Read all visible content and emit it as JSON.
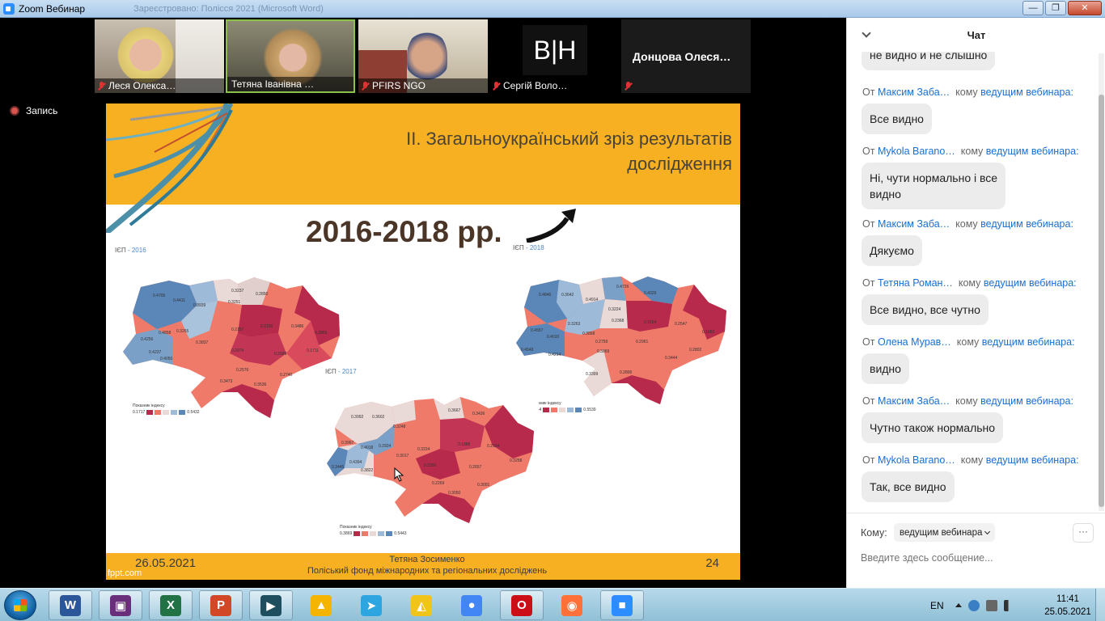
{
  "window": {
    "title": "Zoom Вебинар",
    "background_title": "Зареєстровано: Полісся 2021 (Microsoft Word)",
    "buttons": {
      "minimize": "—",
      "maximize": "❐",
      "close": "✕"
    }
  },
  "participants": [
    {
      "name": "Леся Олекса…",
      "muted": true,
      "active": false
    },
    {
      "name": "Тетяна Іванівна …",
      "muted": false,
      "active": true
    },
    {
      "name": "PFIRS NGO",
      "muted": true,
      "active": false
    },
    {
      "name": "Сергій Воло…",
      "muted": true,
      "active": false,
      "logo": "В|Н"
    },
    {
      "name": "Донцова  Олеся…",
      "muted": true,
      "active": false
    }
  ],
  "recording_label": "Запись",
  "slide": {
    "title_line1": "ІІ. Загальноукраїнський зріз  результатів",
    "title_line2": "дослідження",
    "years": "2016-2018 рр.",
    "maps": [
      {
        "label_prefix": "ІЄП",
        "label_year": " - 2016",
        "legend_title": "Показник індексу",
        "legend_min": "0.1717",
        "legend_max": "0.5432",
        "region_values": [
          "0.4705",
          "0.4411",
          "0.3939",
          "0.3237",
          "0.3251",
          "0.2850",
          "0.4256",
          "0.4858",
          "0.3265",
          "0.2157",
          "0.2156",
          "0.3486",
          "0.3837",
          "0.4237",
          "0.4050",
          "0.3869",
          "0.2074",
          "0.2689",
          "0.1711",
          "0.2576",
          "0.3536",
          "0.2740",
          "0.3473"
        ]
      },
      {
        "label_prefix": "ІЄП",
        "label_year": " - 2017",
        "legend_title": "Показник індексу",
        "legend_min": "0.3869",
        "legend_max": "0.5443",
        "region_values": [
          "0.3992",
          "0.3602",
          "0.3667",
          "0.3436",
          "0.3248",
          "0.3967",
          "0.4018",
          "0.2924",
          "0.3224",
          "0.4394",
          "0.3017",
          "0.1888",
          "0.2154",
          "0.3445",
          "0.3822",
          "0.2950",
          "0.2657",
          "0.2269",
          "0.3258",
          "0.3050",
          "0.3001"
        ]
      },
      {
        "label_prefix": "ІЄП",
        "label_year": " - 2018",
        "legend_title": "Показник індексу",
        "legend_min": "0.1664",
        "legend_max": "0.5539",
        "region_values": [
          "0.4846",
          "0.3642",
          "0.4914",
          "0.4726",
          "0.4029",
          "0.4557",
          "0.4010",
          "0.3263",
          "0.3224",
          "0.2368",
          "0.1624",
          "0.2547",
          "0.4548",
          "0.4214",
          "0.3868",
          "0.2759",
          "0.3869",
          "0.2961",
          "0.1669",
          "0.3444",
          "0.2802",
          "0.2806",
          "0.3399"
        ]
      }
    ],
    "footer_date": "26.05.2021",
    "footer_author": "Тетяна Зосименко",
    "footer_org": "Поліський фонд міжнародних та регіональних досліджень",
    "footer_page": "24",
    "watermark": "fppt.com",
    "colors": {
      "band": "#f6b021",
      "dark_red": "#b82a4b",
      "salmon": "#ef7a6a",
      "pale": "#e9d9d7",
      "light_blue": "#9dbbd9",
      "blue": "#5a86b8"
    }
  },
  "chat": {
    "title": "Чат",
    "from_word": "От",
    "to_word": "кому",
    "messages": [
      {
        "sender": "",
        "recipient": "",
        "text": "не видно и не слышно",
        "partial": true
      },
      {
        "sender": "Максим Заба…",
        "recipient": "ведущим вебинара:",
        "text": "Все видно"
      },
      {
        "sender": "Mykola Barano…",
        "recipient": "ведущим вебинара:",
        "text_line1": "Ні, чути нормально і все",
        "text_line2": "видно"
      },
      {
        "sender": "Максим Заба…",
        "recipient": "ведущим вебинара:",
        "text": "Дякуємо"
      },
      {
        "sender": "Тетяна Роман…",
        "recipient": "ведущим вебинара:",
        "text": "Все видно, все чутно"
      },
      {
        "sender": "Олена Мурав…",
        "recipient": "ведущим вебинара:",
        "text": "видно"
      },
      {
        "sender": "Максим Заба…",
        "recipient": "ведущим вебинара:",
        "text": "Чутно також нормально"
      },
      {
        "sender": "Mykola Barano…",
        "recipient": "ведущим вебинара:",
        "text": "Так, все видно"
      }
    ],
    "to_label": "Кому:",
    "to_value": "ведущим вебинара",
    "more": "···",
    "input_placeholder": "Введите здесь сообщение..."
  },
  "taskbar": {
    "apps": [
      {
        "name": "word",
        "glyph": "W",
        "color": "#2b579a",
        "pinned": true
      },
      {
        "name": "save",
        "glyph": "▣",
        "color": "#6a2f7a",
        "pinned": true
      },
      {
        "name": "excel",
        "glyph": "X",
        "color": "#217346",
        "pinned": true
      },
      {
        "name": "powerpoint",
        "glyph": "P",
        "color": "#d24726",
        "pinned": true
      },
      {
        "name": "screen-recorder",
        "glyph": "▶",
        "color": "#1f4e5f",
        "pinned": true
      },
      {
        "name": "google-drive",
        "glyph": "▲",
        "color": "#f4b400",
        "pinned": false
      },
      {
        "name": "telegram",
        "glyph": "➤",
        "color": "#2ca5e0",
        "pinned": false
      },
      {
        "name": "archicad",
        "glyph": "◭",
        "color": "#f0c419",
        "pinned": false
      },
      {
        "name": "chrome",
        "glyph": "●",
        "color": "#4285f4",
        "pinned": false
      },
      {
        "name": "opera",
        "glyph": "O",
        "color": "#cc0f16",
        "pinned": true
      },
      {
        "name": "firefox",
        "glyph": "◉",
        "color": "#ff7139",
        "pinned": false
      },
      {
        "name": "zoom",
        "glyph": "■",
        "color": "#2d8cff",
        "pinned": true
      }
    ],
    "language": "EN",
    "time": "11:41",
    "date": "25.05.2021"
  }
}
